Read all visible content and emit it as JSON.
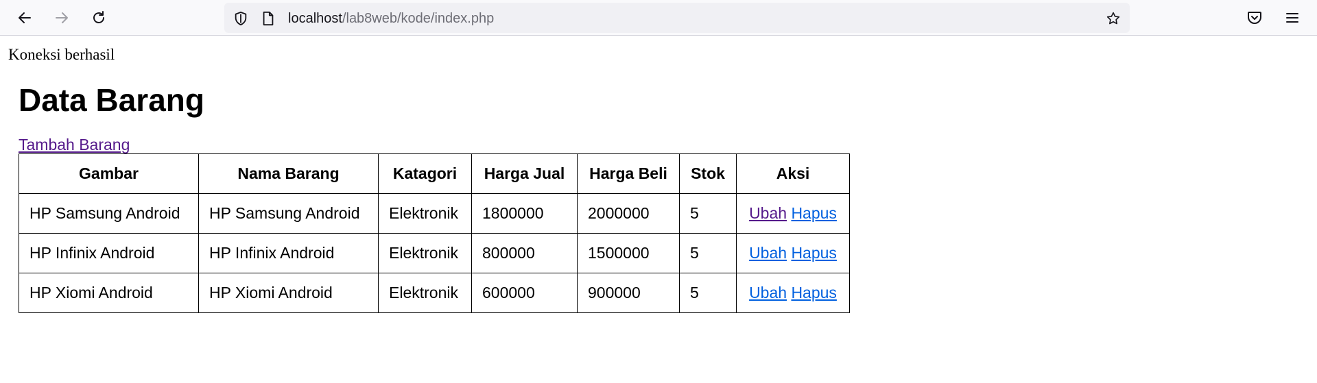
{
  "browser": {
    "url_host": "localhost",
    "url_path": "/lab8web/kode/index.php",
    "icons": {
      "back": "arrow-left-icon",
      "forward": "arrow-right-icon",
      "reload": "reload-icon",
      "tracking": "shield-icon",
      "page": "page-icon",
      "bookmark": "star-icon",
      "pocket": "pocket-icon",
      "menu": "hamburger-menu-icon"
    }
  },
  "page": {
    "status": "Koneksi berhasil",
    "title": "Data Barang",
    "add_link": "Tambah Barang",
    "table": {
      "headers": [
        "Gambar",
        "Nama Barang",
        "Katagori",
        "Harga Jual",
        "Harga Beli",
        "Stok",
        "Aksi"
      ],
      "rows": [
        {
          "gambar": "HP Samsung Android",
          "nama": "HP Samsung Android",
          "kategori": "Elektronik",
          "harga_jual": "1800000",
          "harga_beli": "2000000",
          "stok": "5",
          "ubah": "Ubah",
          "hapus": "Hapus"
        },
        {
          "gambar": "HP Infinix Android",
          "nama": "HP Infinix Android",
          "kategori": "Elektronik",
          "harga_jual": "800000",
          "harga_beli": "1500000",
          "stok": "5",
          "ubah": "Ubah",
          "hapus": "Hapus"
        },
        {
          "gambar": "HP Xiomi Android",
          "nama": "HP Xiomi Android",
          "kategori": "Elektronik",
          "harga_jual": "600000",
          "harga_beli": "900000",
          "stok": "5",
          "ubah": "Ubah",
          "hapus": "Hapus"
        }
      ]
    }
  },
  "colors": {
    "visited_link": "#551a8b",
    "link": "#0060df"
  }
}
